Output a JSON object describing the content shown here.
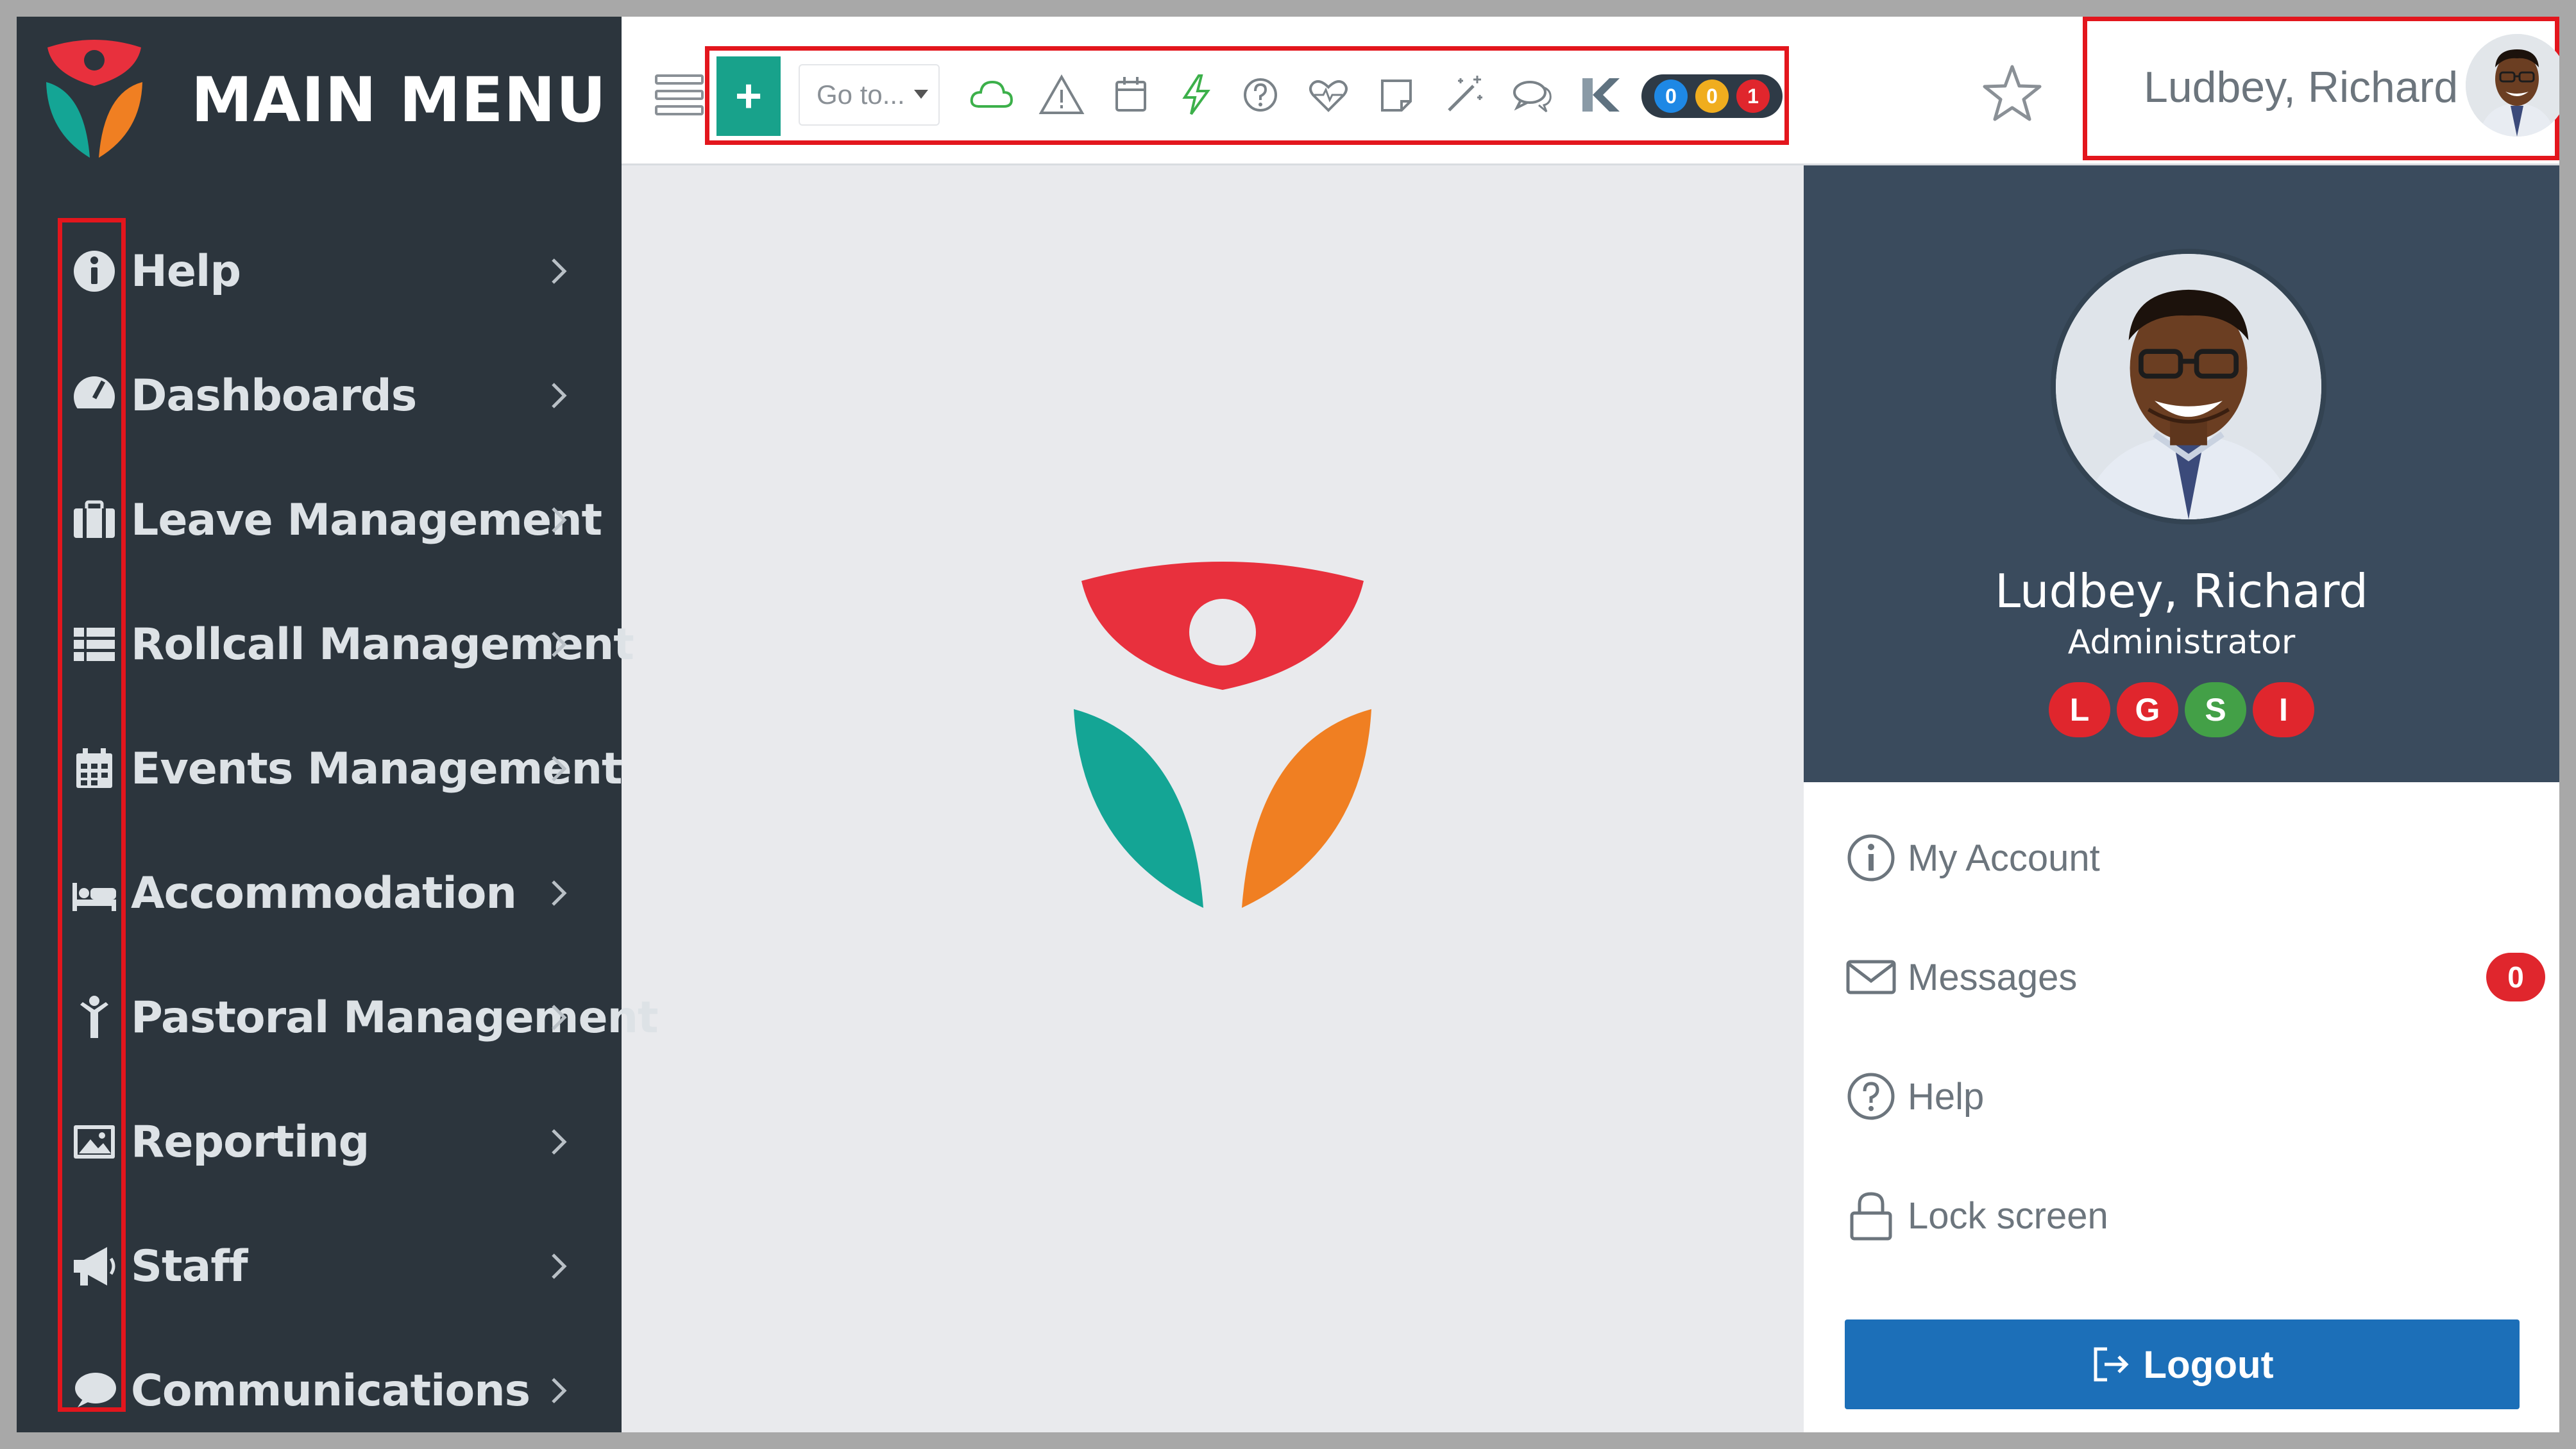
{
  "sidebar": {
    "title": "MAIN MENU",
    "items": [
      {
        "label": "Help",
        "icon": "info-circle-icon"
      },
      {
        "label": "Dashboards",
        "icon": "gauge-icon"
      },
      {
        "label": "Leave Management",
        "icon": "briefcase-icon"
      },
      {
        "label": "Rollcall Management",
        "icon": "list-icon"
      },
      {
        "label": "Events Management",
        "icon": "calendar-icon"
      },
      {
        "label": "Accommodation",
        "icon": "bed-icon"
      },
      {
        "label": "Pastoral Management",
        "icon": "person-icon"
      },
      {
        "label": "Reporting",
        "icon": "image-icon"
      },
      {
        "label": "Staff",
        "icon": "megaphone-icon"
      },
      {
        "label": "Communications",
        "icon": "speech-bubble-icon"
      }
    ]
  },
  "toolbar": {
    "add_label": "+",
    "goto_placeholder": "Go to...",
    "icons": [
      "cloud-icon",
      "warning-icon",
      "calendar-icon",
      "lightning-icon",
      "question-icon",
      "heartbeat-icon",
      "note-icon",
      "magic-wand-icon",
      "chat-icon",
      "k-logo-icon"
    ],
    "counters": [
      {
        "value": "0",
        "color": "#1e88e5"
      },
      {
        "value": "0",
        "color": "#f0ad1e"
      },
      {
        "value": "1",
        "color": "#e0262d"
      }
    ]
  },
  "user": {
    "name": "Ludbey, Richard",
    "role": "Administrator",
    "badges": [
      {
        "letter": "L",
        "color": "#e0262d"
      },
      {
        "letter": "G",
        "color": "#e0262d"
      },
      {
        "letter": "S",
        "color": "#43a047"
      },
      {
        "letter": "I",
        "color": "#e0262d"
      }
    ]
  },
  "profile_menu": {
    "my_account": "My Account",
    "messages": "Messages",
    "messages_count": "0",
    "help": "Help",
    "lock_screen": "Lock screen",
    "logout": "Logout"
  },
  "colors": {
    "sidebar_bg": "#2c353d",
    "accent_teal": "#18a28b",
    "logo_red": "#e8303d",
    "logo_teal": "#14a595",
    "logo_orange": "#f07f22",
    "logout_blue": "#1c6fb8",
    "highlight_red": "#e3161d"
  }
}
